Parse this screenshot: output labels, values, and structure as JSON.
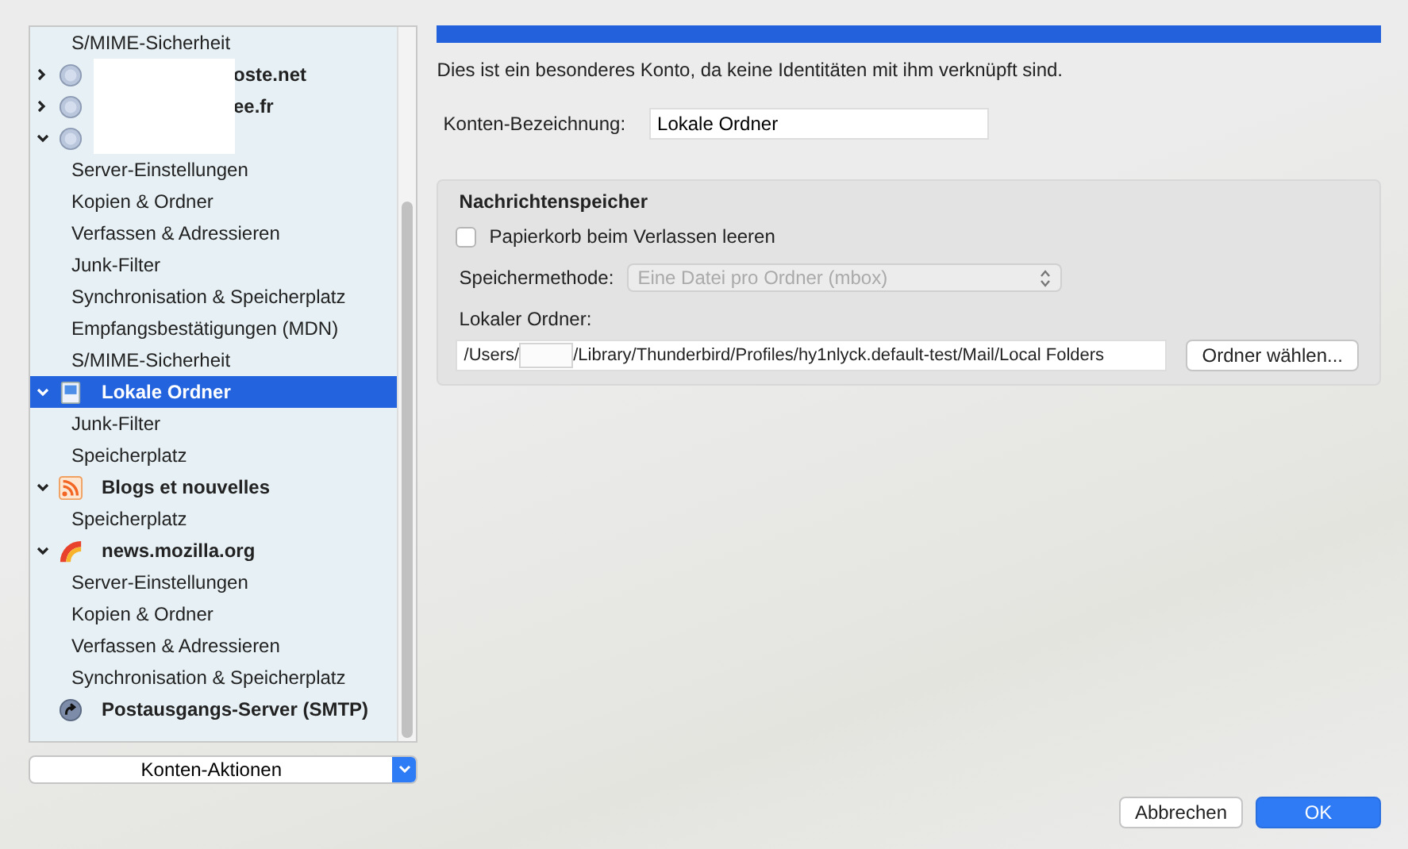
{
  "tree": [
    {
      "kind": "page",
      "label": "S/MIME-Sicherheit",
      "selected": false
    },
    {
      "kind": "mail",
      "label": "oste.net",
      "redacted": true,
      "expanded": false,
      "selected": false
    },
    {
      "kind": "mail",
      "label": "ee.fr",
      "redacted": true,
      "expanded": false,
      "selected": false
    },
    {
      "kind": "mail",
      "redacted": true,
      "expanded": true,
      "selected": false,
      "children": [
        {
          "kind": "page",
          "label": "Server-Einstellungen",
          "selected": false
        },
        {
          "kind": "page",
          "label": "Kopien & Ordner",
          "selected": false
        },
        {
          "kind": "page",
          "label": "Verfassen & Adressieren",
          "selected": false
        },
        {
          "kind": "page",
          "label": "Junk-Filter",
          "selected": false
        },
        {
          "kind": "page",
          "label": "Synchronisation & Speicherplatz",
          "selected": false
        },
        {
          "kind": "page",
          "label": "Empfangsbestätigungen (MDN)",
          "selected": false
        },
        {
          "kind": "page",
          "label": "S/MIME-Sicherheit",
          "selected": false
        }
      ]
    },
    {
      "kind": "local",
      "label": "Lokale Ordner",
      "expanded": true,
      "selected": true,
      "children": [
        {
          "kind": "page",
          "label": "Junk-Filter",
          "selected": false
        },
        {
          "kind": "page",
          "label": "Speicherplatz",
          "selected": false
        }
      ]
    },
    {
      "kind": "rss",
      "label": "Blogs et nouvelles",
      "expanded": true,
      "selected": false,
      "children": [
        {
          "kind": "page",
          "label": "Speicherplatz",
          "selected": false
        }
      ]
    },
    {
      "kind": "news",
      "label": "news.mozilla.org",
      "expanded": true,
      "selected": false,
      "children": [
        {
          "kind": "page",
          "label": "Server-Einstellungen",
          "selected": false
        },
        {
          "kind": "page",
          "label": "Kopien & Ordner",
          "selected": false
        },
        {
          "kind": "page",
          "label": "Verfassen & Adressieren",
          "selected": false
        },
        {
          "kind": "page",
          "label": "Synchronisation & Speicherplatz",
          "selected": false
        }
      ]
    },
    {
      "kind": "smtp",
      "label": "Postausgangs-Server (SMTP)",
      "selected": false
    }
  ],
  "account_actions": "Konten-Aktionen",
  "info_text": "Dies ist ein besonderes Konto, da keine Identitäten mit ihm verknüpft sind.",
  "account_name": {
    "label": "Konten-Bezeichnung:",
    "value": "Lokale Ordner"
  },
  "message_store": {
    "title": "Nachrichtenspeicher",
    "empty_trash": {
      "label": "Papierkorb beim Verlassen leeren",
      "checked": false
    },
    "store_type": {
      "label": "Speichermethode:",
      "value": "Eine Datei pro Ordner (mbox)",
      "disabled": true
    },
    "local_dir": {
      "label": "Lokaler Ordner:",
      "value_start": "/Users/",
      "value_end": "/Library/Thunderbird/Profiles/hy1nlyck.default-test/Mail/Local Folders",
      "redacted": true
    },
    "browse_button": "Ordner wählen..."
  },
  "buttons": [
    {
      "label": "Abbrechen",
      "primary": false
    },
    {
      "label": "OK",
      "primary": true
    }
  ]
}
